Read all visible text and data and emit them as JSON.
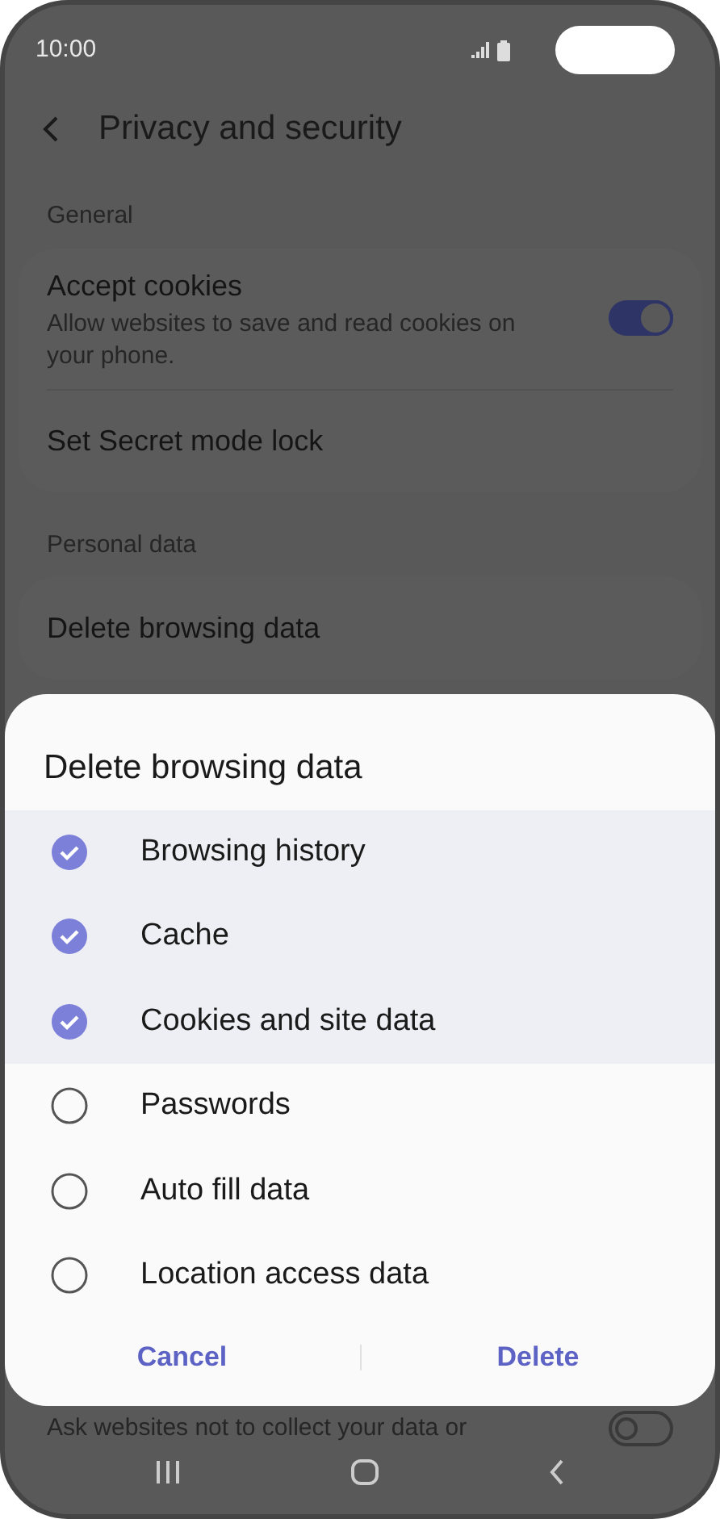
{
  "status_bar": {
    "time": "10:00"
  },
  "header": {
    "title": "Privacy and security"
  },
  "sections": [
    {
      "title": "General",
      "items": [
        {
          "kind": "switch",
          "label": "Accept cookies",
          "description": "Allow websites to save and read cookies on your phone.",
          "on": true
        },
        {
          "kind": "plain",
          "label": "Set Secret mode lock"
        }
      ]
    },
    {
      "title": "Personal data",
      "items": [
        {
          "kind": "plain",
          "label": "Delete browsing data"
        }
      ]
    }
  ],
  "partial_row": {
    "description": "Ask websites not to collect your data or",
    "on": false
  },
  "dialog": {
    "title": "Delete browsing data",
    "options": [
      {
        "label": "Browsing history",
        "checked": true
      },
      {
        "label": "Cache",
        "checked": true
      },
      {
        "label": "Cookies and site data",
        "checked": true
      },
      {
        "label": "Passwords",
        "checked": false
      },
      {
        "label": "Auto fill data",
        "checked": false
      },
      {
        "label": "Location access data",
        "checked": false
      }
    ],
    "buttons": [
      "Cancel",
      "Delete"
    ]
  }
}
